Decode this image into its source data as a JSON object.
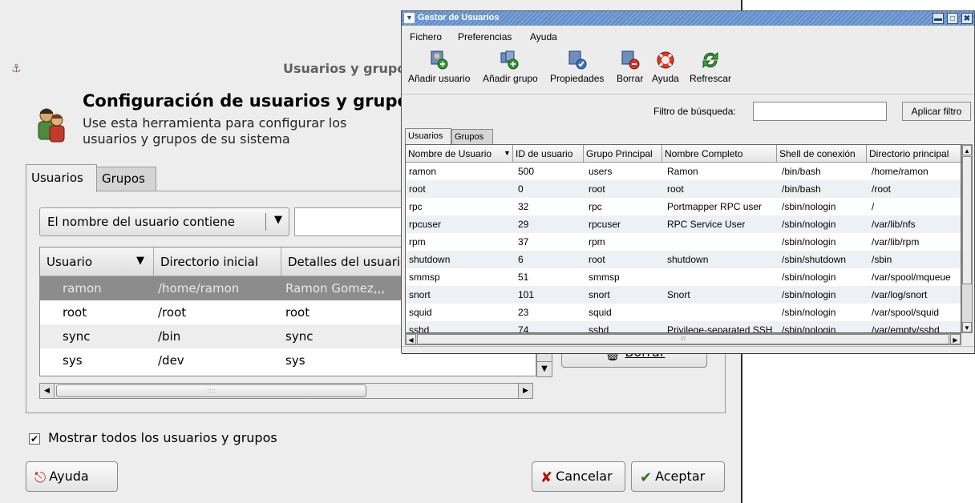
{
  "back_window": {
    "title": "Usuarios y grupos",
    "header_title": "Configuración de usuarios y grupos",
    "header_subtitle": "Use esta herramienta para configurar los usuarios y grupos de su sistema",
    "tabs": [
      "Usuarios",
      "Grupos"
    ],
    "filter_combo": "El nombre del usuario contiene",
    "filter_value": "",
    "columns": [
      "Usuario",
      "Directorio inicial",
      "Detalles del usuario"
    ],
    "rows": [
      {
        "user": "ramon",
        "home": "/home/ramon",
        "details": "Ramon Gomez,,,",
        "selected": true
      },
      {
        "user": "root",
        "home": "/root",
        "details": "root",
        "selected": false
      },
      {
        "user": "sync",
        "home": "/bin",
        "details": "sync",
        "selected": false
      },
      {
        "user": "sys",
        "home": "/dev",
        "details": "sys",
        "selected": false
      }
    ],
    "delete_button": "Borrar",
    "show_all_label": "Mostrar todos los usuarios y grupos",
    "show_all_checked": true,
    "help_button": "Ayuda",
    "cancel_button": "Cancelar",
    "accept_button": "Aceptar"
  },
  "front_window": {
    "title": "Gestor de Usuarios",
    "menu": [
      "Fichero",
      "Preferencias",
      "Ayuda"
    ],
    "toolbar": [
      {
        "label": "Añadir usuario",
        "icon": "add-user-icon"
      },
      {
        "label": "Añadir grupo",
        "icon": "add-group-icon"
      },
      {
        "label": "Propiedades",
        "icon": "properties-icon"
      },
      {
        "label": "Borrar",
        "icon": "delete-icon"
      },
      {
        "label": "Ayuda",
        "icon": "help-icon"
      },
      {
        "label": "Refrescar",
        "icon": "refresh-icon"
      }
    ],
    "filter_label": "Filtro de búsqueda:",
    "filter_value": "",
    "apply_filter_button": "Aplicar filtro",
    "tabs": [
      "Usuarios",
      "Grupos"
    ],
    "columns": [
      "Nombre de Usuario",
      "ID de usuario",
      "Grupo Principal",
      "Nombre Completo",
      "Shell de conexión",
      "Directorio principal"
    ],
    "rows": [
      [
        "ramon",
        "500",
        "users",
        "Ramon",
        "/bin/bash",
        "/home/ramon"
      ],
      [
        "root",
        "0",
        "root",
        "root",
        "/bin/bash",
        "/root"
      ],
      [
        "rpc",
        "32",
        "rpc",
        "Portmapper RPC user",
        "/sbin/nologin",
        "/"
      ],
      [
        "rpcuser",
        "29",
        "rpcuser",
        "RPC Service User",
        "/sbin/nologin",
        "/var/lib/nfs"
      ],
      [
        "rpm",
        "37",
        "rpm",
        "",
        "/sbin/nologin",
        "/var/lib/rpm"
      ],
      [
        "shutdown",
        "6",
        "root",
        "shutdown",
        "/sbin/shutdown",
        "/sbin"
      ],
      [
        "smmsp",
        "51",
        "smmsp",
        "",
        "/sbin/nologin",
        "/var/spool/mqueue"
      ],
      [
        "snort",
        "101",
        "snort",
        "Snort",
        "/sbin/nologin",
        "/var/log/snort"
      ],
      [
        "squid",
        "23",
        "squid",
        "",
        "/sbin/nologin",
        "/var/spool/squid"
      ],
      [
        "sshd",
        "74",
        "sshd",
        "Privilege-separated SSH",
        "/sbin/nologin",
        "/var/empty/sshd"
      ]
    ]
  }
}
